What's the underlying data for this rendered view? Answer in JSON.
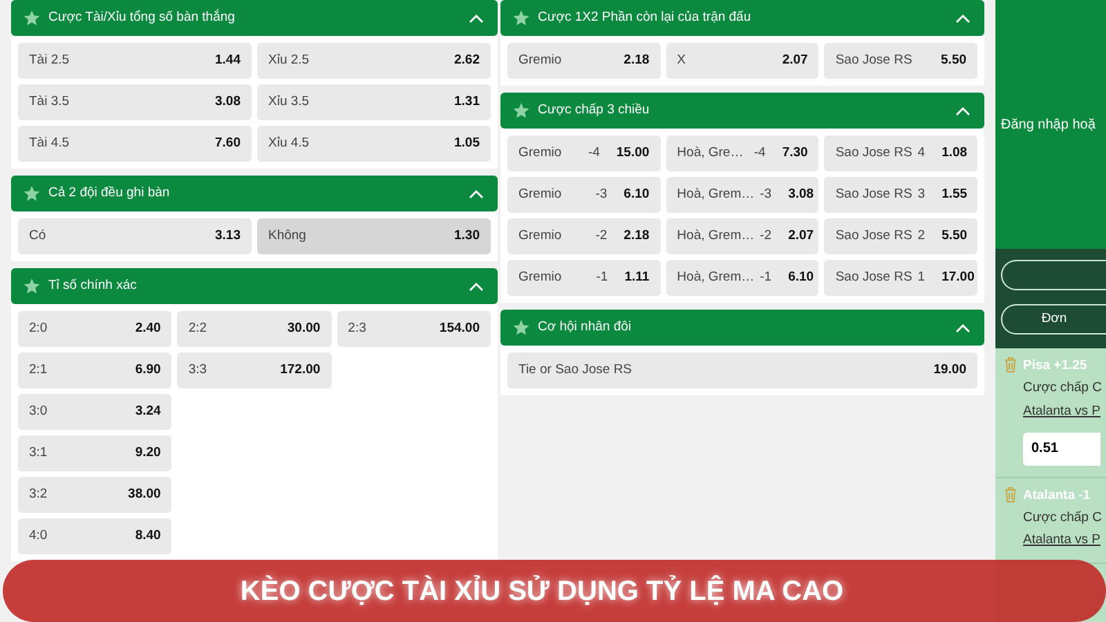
{
  "left_column": [
    {
      "title": "Cược Tài/Xỉu tổng số bàn thắng",
      "expanded": true,
      "columns": [
        [
          {
            "label": "Tài 2.5",
            "odds": "1.44",
            "selected": false
          },
          {
            "label": "Tài 3.5",
            "odds": "3.08",
            "selected": false
          },
          {
            "label": "Tài 4.5",
            "odds": "7.60",
            "selected": false
          }
        ],
        [
          {
            "label": "Xỉu 2.5",
            "odds": "2.62",
            "selected": false
          },
          {
            "label": "Xỉu 3.5",
            "odds": "1.31",
            "selected": false
          },
          {
            "label": "Xỉu 4.5",
            "odds": "1.05",
            "selected": false
          }
        ]
      ]
    },
    {
      "title": "Cả 2 đội đều ghi bàn",
      "expanded": true,
      "columns": [
        [
          {
            "label": "Có",
            "odds": "3.13",
            "selected": false
          }
        ],
        [
          {
            "label": "Không",
            "odds": "1.30",
            "selected": true
          }
        ]
      ]
    },
    {
      "title": "Tỉ số chính xác",
      "expanded": true,
      "columns": [
        [
          {
            "label": "2:0",
            "odds": "2.40",
            "selected": false
          },
          {
            "label": "2:1",
            "odds": "6.90",
            "selected": false
          },
          {
            "label": "3:0",
            "odds": "3.24",
            "selected": false
          },
          {
            "label": "3:1",
            "odds": "9.20",
            "selected": false
          },
          {
            "label": "3:2",
            "odds": "38.00",
            "selected": false
          },
          {
            "label": "4:0",
            "odds": "8.40",
            "selected": false
          }
        ],
        [
          {
            "label": "2:2",
            "odds": "30.00",
            "selected": false
          },
          {
            "label": "3:3",
            "odds": "172.00",
            "selected": false
          }
        ],
        [
          {
            "label": "2:3",
            "odds": "154.00",
            "selected": false
          }
        ]
      ]
    }
  ],
  "middle_column": [
    {
      "title": "Cược 1X2 Phần còn lại của trận đấu",
      "expanded": true,
      "columns": [
        [
          {
            "label": "Gremio",
            "odds": "2.18",
            "selected": false
          }
        ],
        [
          {
            "label": "X",
            "odds": "2.07",
            "selected": false
          }
        ],
        [
          {
            "label": "Sao Jose RS",
            "odds": "5.50",
            "selected": false
          }
        ]
      ]
    },
    {
      "title": "Cược chấp 3 chiều",
      "expanded": true,
      "columns": [
        [
          {
            "label": "Gremio",
            "line": "-4",
            "odds": "15.00",
            "selected": false
          },
          {
            "label": "Gremio",
            "line": "-3",
            "odds": "6.10",
            "selected": false
          },
          {
            "label": "Gremio",
            "line": "-2",
            "odds": "2.18",
            "selected": false
          },
          {
            "label": "Gremio",
            "line": "-1",
            "odds": "1.11",
            "selected": false
          }
        ],
        [
          {
            "label": "Hoà, Gre…",
            "line": "-4",
            "odds": "7.30",
            "selected": false
          },
          {
            "label": "Hoà, Grem…",
            "line": "-3",
            "odds": "3.08",
            "selected": false
          },
          {
            "label": "Hoà, Grem…",
            "line": "-2",
            "odds": "2.07",
            "selected": false
          },
          {
            "label": "Hoà, Grem…",
            "line": "-1",
            "odds": "6.10",
            "selected": false
          }
        ],
        [
          {
            "label": "Sao Jose RS",
            "line": "4",
            "odds": "1.08",
            "selected": false
          },
          {
            "label": "Sao Jose RS",
            "line": "3",
            "odds": "1.55",
            "selected": false
          },
          {
            "label": "Sao Jose RS",
            "line": "2",
            "odds": "5.50",
            "selected": false
          },
          {
            "label": "Sao Jose RS",
            "line": "1",
            "odds": "17.00",
            "selected": false
          }
        ]
      ]
    },
    {
      "title": "Cơ hội nhân đôi",
      "expanded": true,
      "columns": [
        [
          {
            "label": "Tie or Sao Jose RS",
            "odds": "19.00",
            "selected": false
          }
        ]
      ]
    }
  ],
  "bet_slip": {
    "login_text": "Đăng nhập hoặ",
    "bet_type_label": "Đơn",
    "bets": [
      {
        "selection": "Pisa +1.25",
        "market": "Cược chấp C",
        "match": "Atalanta vs P",
        "stake": "0.51"
      },
      {
        "selection": "Atalanta -1",
        "market": "Cược chấp C",
        "match": "Atalanta vs P"
      }
    ]
  },
  "banner": "KÈO CƯỢC TÀI XỈU SỬ DỤNG TỶ LỆ MA CAO"
}
